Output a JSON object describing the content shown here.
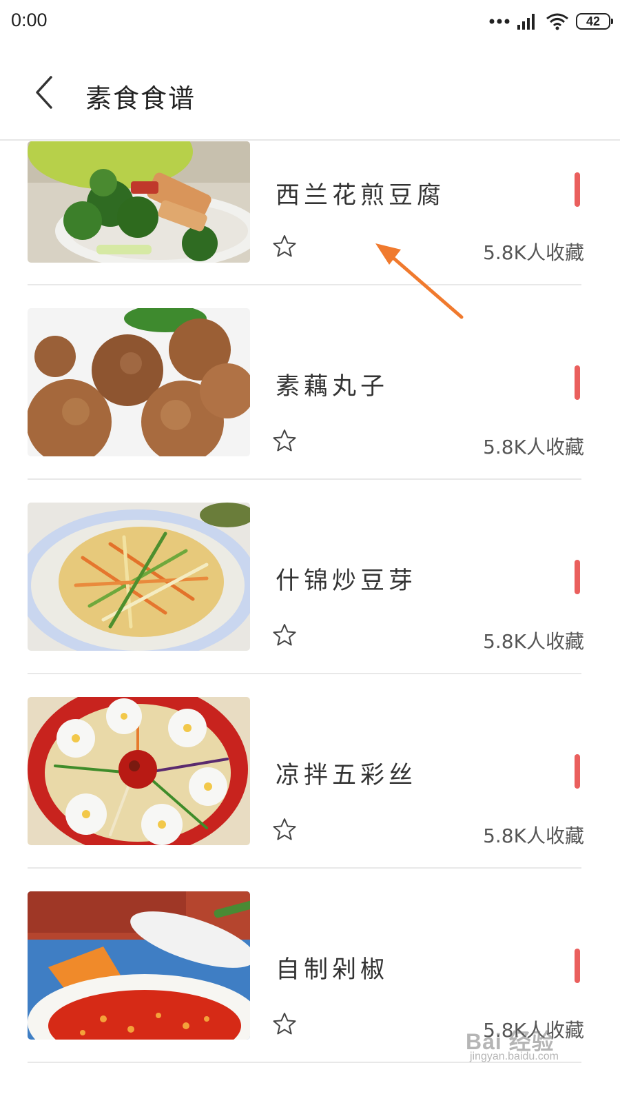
{
  "status_bar": {
    "time": "0:00",
    "battery": "42",
    "icons": [
      "dots-icon",
      "signal-icon",
      "wifi-icon",
      "battery-icon"
    ]
  },
  "header": {
    "title": "素食食谱",
    "back_icon": "chevron-left-icon"
  },
  "recipes": [
    {
      "name": "西兰花煎豆腐",
      "favorites": "5.8K人收藏",
      "image": "broccoli-tofu"
    },
    {
      "name": "素藕丸子",
      "favorites": "5.8K人收藏",
      "image": "lotus-root-balls"
    },
    {
      "name": "什锦炒豆芽",
      "favorites": "5.8K人收藏",
      "image": "stir-fried-sprouts"
    },
    {
      "name": "凉拌五彩丝",
      "favorites": "5.8K人收藏",
      "image": "five-color-salad"
    },
    {
      "name": "自制剁椒",
      "favorites": "5.8K人收藏",
      "image": "chopped-chili"
    }
  ],
  "watermark": {
    "main": "Bai 经验",
    "sub": "jingyan.baidu.com"
  },
  "colors": {
    "accent_mark": "#ea5f5d",
    "annotation_arrow": "#f07a2e",
    "divider": "#e8e8e8"
  }
}
